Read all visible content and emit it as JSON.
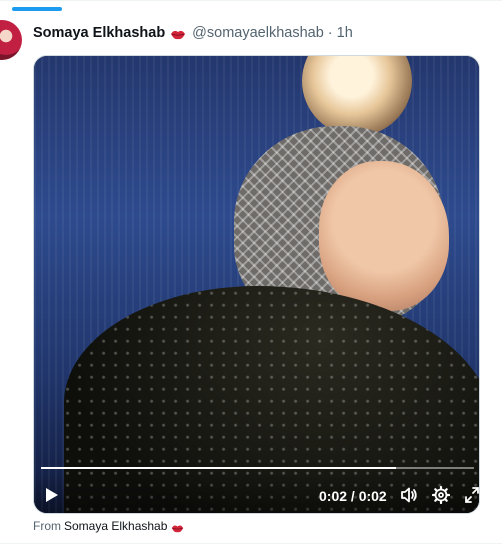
{
  "post": {
    "author_name": "Somaya Elkhashab",
    "handle": "@somayaelkhashab",
    "separator": "·",
    "time": "1h",
    "emoji_icon": "lips-icon"
  },
  "video": {
    "time_display": "0:02 / 0:02",
    "progress_fraction": 0.82,
    "controls": {
      "play_icon": "play-icon",
      "volume_icon": "volume-icon",
      "settings_icon": "gear-icon",
      "fullscreen_icon": "expand-icon"
    }
  },
  "attribution": {
    "label": "From",
    "author_name": "Somaya Elkhashab"
  },
  "colors": {
    "accent": "#1d9bf0",
    "text_primary": "#0f1419",
    "text_secondary": "#536471",
    "lips": "#d4243a"
  }
}
